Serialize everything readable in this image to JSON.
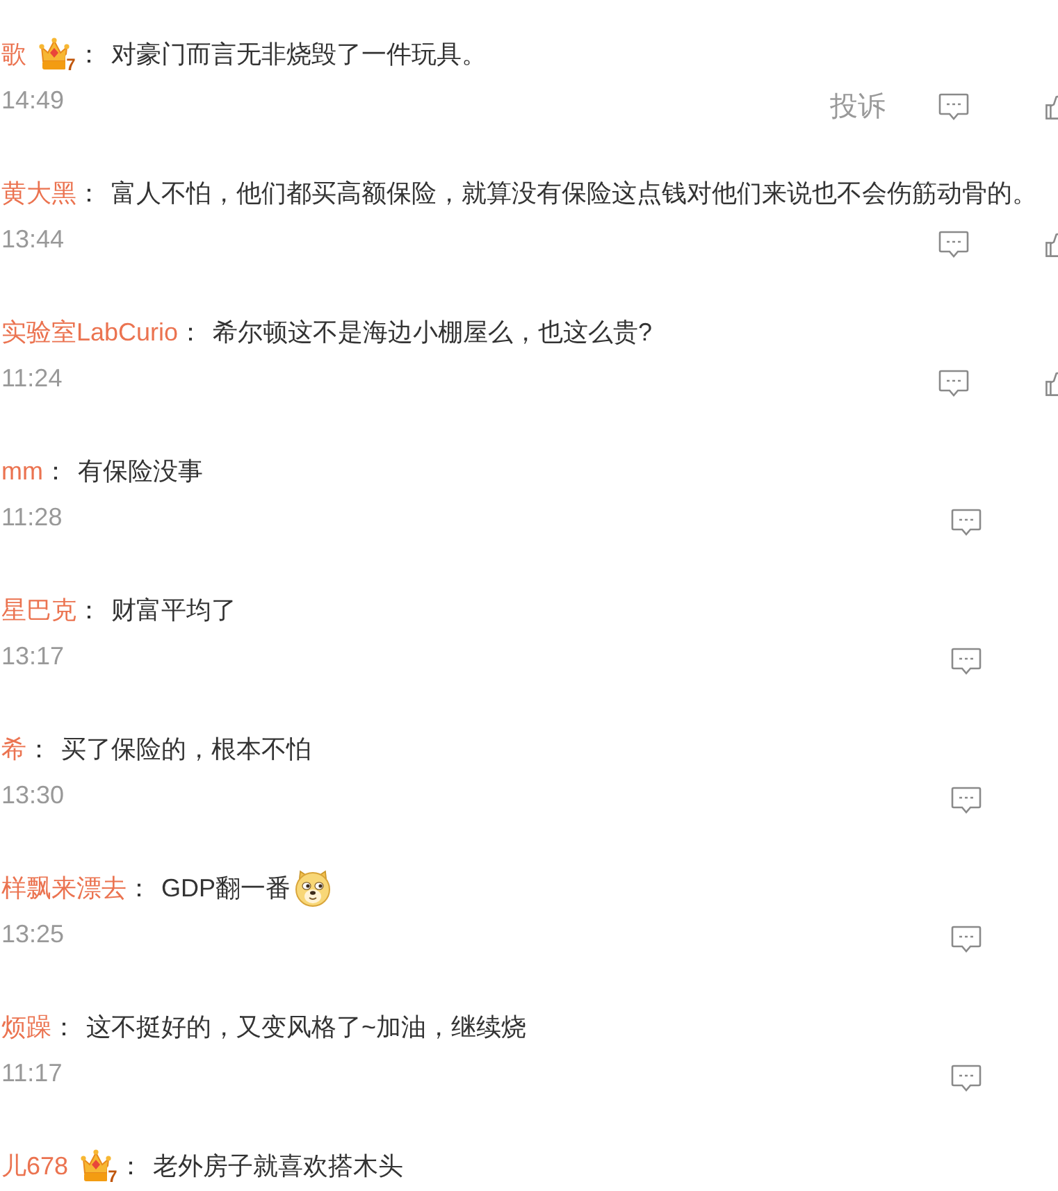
{
  "comments": [
    {
      "username": "歌",
      "vip_level": "7",
      "separator": "：",
      "text": "对豪门而言无非烧毁了一件玩具。",
      "time": "14:49",
      "actions": [
        {
          "kind": "report",
          "label": "投诉"
        },
        {
          "kind": "reply"
        },
        {
          "kind": "like"
        }
      ]
    },
    {
      "username": "黄大黑",
      "separator": "：",
      "text": "富人不怕，他们都买高额保险，就算没有保险这点钱对他们来说也不会伤筋动骨的。",
      "time": "13:44",
      "actions": [
        {
          "kind": "reply"
        },
        {
          "kind": "like"
        }
      ]
    },
    {
      "username": "实验室LabCurio",
      "separator": "：",
      "text": "希尔顿这不是海边小棚屋么，也这么贵?",
      "time": "11:24",
      "actions": [
        {
          "kind": "reply"
        },
        {
          "kind": "like"
        }
      ]
    },
    {
      "username": "mm",
      "separator": "：",
      "text": "有保险没事",
      "time": "11:28",
      "actions": [
        {
          "kind": "reply"
        }
      ]
    },
    {
      "username": "星巴克",
      "separator": "：",
      "text": "财富平均了",
      "time": "13:17",
      "actions": [
        {
          "kind": "reply"
        }
      ]
    },
    {
      "username": "希",
      "separator": "：",
      "text": "买了保险的，根本不怕",
      "time": "13:30",
      "actions": [
        {
          "kind": "reply"
        }
      ]
    },
    {
      "username": "样飘来漂去",
      "separator": "：",
      "text": "GDP翻一番",
      "emoji": {
        "kind": "dog"
      },
      "time": "13:25",
      "actions": [
        {
          "kind": "reply"
        }
      ]
    },
    {
      "username": "烦躁",
      "separator": "：",
      "text": "这不挺好的，又变风格了~加油，继续烧",
      "time": "11:17",
      "actions": [
        {
          "kind": "reply"
        }
      ]
    },
    {
      "username": "儿678",
      "vip_level": "7",
      "separator": "：",
      "text": "老外房子就喜欢搭木头"
    }
  ]
}
